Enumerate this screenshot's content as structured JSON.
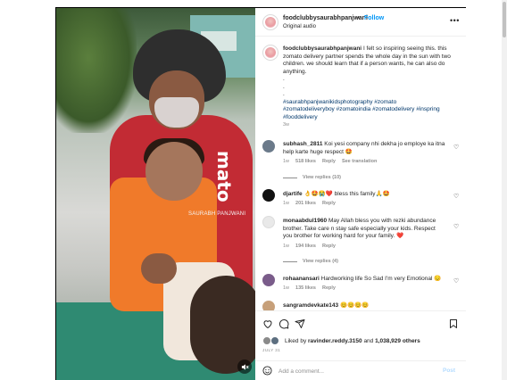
{
  "media": {
    "shirt_text": "mato",
    "watermark": "SAURABH PANJWANI",
    "mute_icon": "speaker-muted-icon"
  },
  "header": {
    "username": "foodclubbysaurabhpanjwani",
    "dot": "•",
    "follow_label": "Follow",
    "subtitle": "Original audio",
    "more_icon": "more-horizontal-icon"
  },
  "caption": {
    "username": "foodclubbysaurabhpanjwani",
    "text": "I felt so inspiring seeing this. this zomato delivery partner spends the whole day in the sun with two children. we should learn that if a person wants, he can also do anything.",
    "dots": [
      ".",
      ".",
      "."
    ],
    "hashtags_line1": "#saurabhpanjwanikidsphotography #zomato",
    "hashtags_line2": "#zomatodeliveryboy #zomatoindia #zomatodelivery #inspring",
    "hashtags_line3": "#fooddelivery",
    "time": "3w"
  },
  "comments": [
    {
      "username": "subhash_2811",
      "text": "Koi yesi company nhi dekha jo employe ka itna help karte huge respect 🤩",
      "time": "1w",
      "likes": "518 likes",
      "reply": "Reply",
      "translation": "See translation",
      "view_replies": "View replies (10)",
      "avatar_color": "#6b7a8a"
    },
    {
      "username": "djartife",
      "text": "👌🤩😭❤️ bless this family🙏🤩",
      "time": "1w",
      "likes": "201 likes",
      "reply": "Reply",
      "avatar_color": "#111111"
    },
    {
      "username": "monaabdul1960",
      "text": "May Allah bless you with rezki abundance brother. Take care n stay safe especially your kids. Respect you brother for working hard for your family. ❤️",
      "time": "1w",
      "likes": "194 likes",
      "reply": "Reply",
      "view_replies": "View replies (4)",
      "avatar_color": "#e9e9e9"
    },
    {
      "username": "rohaanansari",
      "text": "Hardworking life So Sad I'm very Emotional 😔",
      "time": "1w",
      "likes": "135 likes",
      "reply": "Reply",
      "avatar_color": "#7a5c8a"
    },
    {
      "username": "sangramdevkate143",
      "text": "😊😊😊😊",
      "avatar_color": "#c7a07a"
    }
  ],
  "actions": {
    "like_icon": "heart-icon",
    "comment_icon": "comment-icon",
    "share_icon": "send-icon",
    "save_icon": "bookmark-icon",
    "liked_prefix": "Liked by",
    "liked_user": "ravinder.reddy.3150",
    "liked_and": "and",
    "liked_others": "1,038,929 others",
    "date": "JULY 31"
  },
  "add_comment": {
    "placeholder": "Add a comment...",
    "post_label": "Post",
    "emoji_icon": "smiley-icon"
  },
  "colors": {
    "accent": "#0095f6",
    "tag": "#00376b",
    "muted": "#8e8e8e",
    "post_disabled": "#b3dbff"
  }
}
